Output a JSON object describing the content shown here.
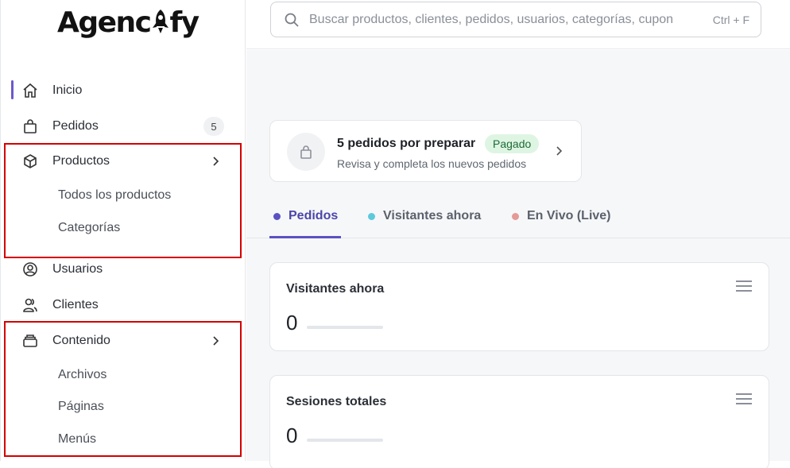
{
  "brand": {
    "name_prefix": "Agenc",
    "name_suffix": "fy"
  },
  "search": {
    "placeholder": "Buscar productos, clientes, pedidos, usuarios, categorías, cupon",
    "shortcut": "Ctrl + F"
  },
  "sidebar": {
    "home": "Inicio",
    "orders": "Pedidos",
    "orders_badge": "5",
    "products": "Productos",
    "products_sub": [
      "Todos los productos",
      "Categorías"
    ],
    "users": "Usuarios",
    "customers": "Clientes",
    "content": "Contenido",
    "content_sub": [
      "Archivos",
      "Páginas",
      "Menús"
    ]
  },
  "order_card": {
    "title": "5 pedidos por preparar",
    "status": "Pagado",
    "subtitle": "Revisa y completa los nuevos pedidos"
  },
  "tabs": [
    {
      "label": "Pedidos",
      "color": "#5a52c2"
    },
    {
      "label": "Visitantes ahora",
      "color": "#5cc9dc"
    },
    {
      "label": "En Vivo (Live)",
      "color": "#e49a97"
    }
  ],
  "metrics": [
    {
      "title": "Visitantes ahora",
      "value": "0"
    },
    {
      "title": "Sesiones totales",
      "value": "0"
    }
  ],
  "annotation_color": "#d40000"
}
